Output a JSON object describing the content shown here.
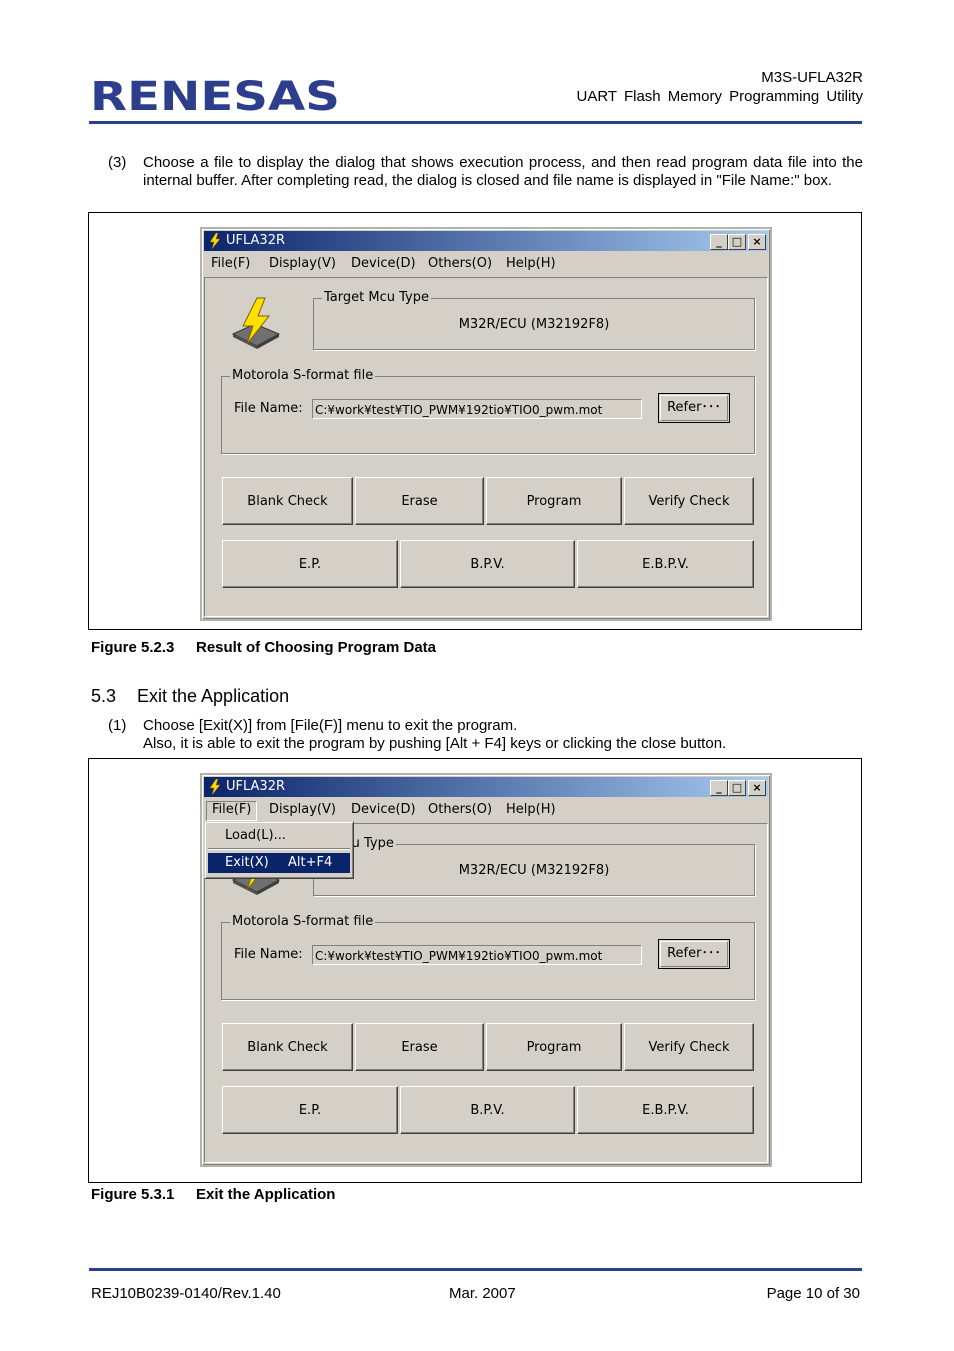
{
  "header": {
    "logo_text": "RENESAS",
    "product": "M3S-UFLA32R",
    "title": "UART  Flash  Memory  Programming  Utility"
  },
  "step3": {
    "number": "(3)",
    "text": "Choose a file to display the dialog that shows execution process, and then read program data file into the internal buffer.  After completing read, the dialog is closed and file name is displayed in \"File Name:\" box."
  },
  "figure1": {
    "caption_number": "Figure 5.2.3",
    "caption_title": "Result of Choosing Program Data"
  },
  "section": {
    "number": "5.3",
    "title": "Exit the Application"
  },
  "step1": {
    "number": "(1)",
    "line1": "Choose [Exit(X)] from [File(F)] menu to exit the program.",
    "line2": "Also, it is able to exit the program by pushing [Alt + F4] keys or clicking the close button."
  },
  "figure2": {
    "caption_number": "Figure 5.3.1",
    "caption_title": "Exit the Application"
  },
  "app": {
    "title": "UFLA32R",
    "controls": {
      "minimize": "_",
      "maximize": "□",
      "close": "×"
    },
    "menu": [
      "File(F)",
      "Display(V)",
      "Device(D)",
      "Others(O)",
      "Help(H)"
    ],
    "target_label": "Target Mcu Type",
    "target_value": "M32R/ECU (M32192F8)",
    "file_group_label": "Motorola S-format file",
    "file_name_label": "File Name:",
    "file_name_value": "C:¥work¥test¥TIO_PWM¥192tio¥TIO0_pwm.mot",
    "refer_label": "Refer･･･",
    "buttons_row1": [
      "Blank Check",
      "Erase",
      "Program",
      "Verify Check"
    ],
    "buttons_row2": [
      "E.P.",
      "B.P.V.",
      "E.B.P.V."
    ],
    "file_menu": {
      "load": "Load(L)...",
      "exit": "Exit(X)",
      "exit_accel": "Alt+F4",
      "target_label_partial": "t Mcu Type"
    }
  },
  "footer": {
    "doc_id": "REJ10B0239-0140/Rev.1.40",
    "date": "Mar. 2007",
    "page": "Page 10 of 30"
  },
  "colors": {
    "brand_blue": "#2c3e8c",
    "title_bar": "#0a246a",
    "dialog_face": "#d4d0c8"
  }
}
